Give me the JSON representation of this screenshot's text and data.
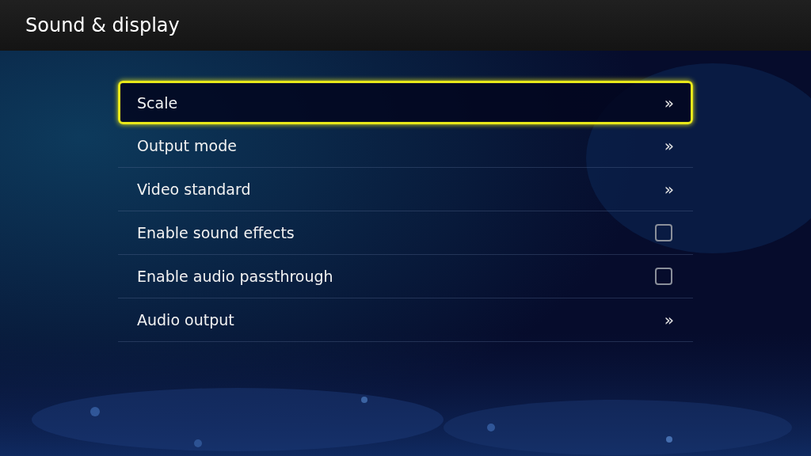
{
  "header": {
    "title": "Sound & display"
  },
  "items": [
    {
      "kind": "submenu",
      "label": "Scale",
      "selected": true,
      "arrow": "»"
    },
    {
      "kind": "submenu",
      "label": "Output mode",
      "selected": false,
      "arrow": "»"
    },
    {
      "kind": "submenu",
      "label": "Video standard",
      "selected": false,
      "arrow": "»"
    },
    {
      "kind": "checkbox",
      "label": "Enable sound effects",
      "selected": false,
      "checked": false
    },
    {
      "kind": "checkbox",
      "label": "Enable audio passthrough",
      "selected": false,
      "checked": false
    },
    {
      "kind": "submenu",
      "label": "Audio output",
      "selected": false,
      "arrow": "»"
    }
  ]
}
